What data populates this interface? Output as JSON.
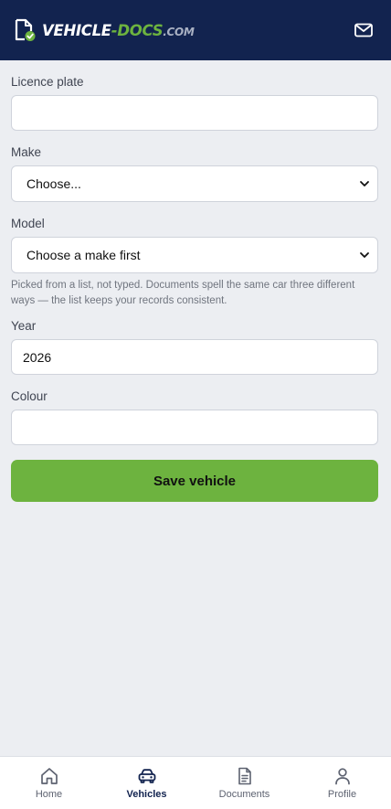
{
  "header": {
    "brand_part1": "VEHICLE",
    "brand_part2": "-DOCS",
    "brand_part3": ".COM",
    "logo_icon": "document-check-icon",
    "mail_icon": "mail-icon"
  },
  "form": {
    "licence_plate": {
      "label": "Licence plate",
      "value": ""
    },
    "make": {
      "label": "Make",
      "selected": "Choose..."
    },
    "model": {
      "label": "Model",
      "selected": "Choose a make first",
      "help": "Picked from a list, not typed. Documents spell the same car three different ways — the list keeps your records consistent."
    },
    "year": {
      "label": "Year",
      "value": "2026"
    },
    "colour": {
      "label": "Colour",
      "value": ""
    },
    "save_label": "Save vehicle"
  },
  "tabbar": {
    "tabs": [
      {
        "label": "Home",
        "icon": "home-icon",
        "active": false
      },
      {
        "label": "Vehicles",
        "icon": "car-icon",
        "active": true
      },
      {
        "label": "Documents",
        "icon": "document-icon",
        "active": false
      },
      {
        "label": "Profile",
        "icon": "user-icon",
        "active": false
      }
    ]
  },
  "colors": {
    "header_bg": "#12234f",
    "accent_green": "#6db33f",
    "page_bg": "#eceef2"
  }
}
